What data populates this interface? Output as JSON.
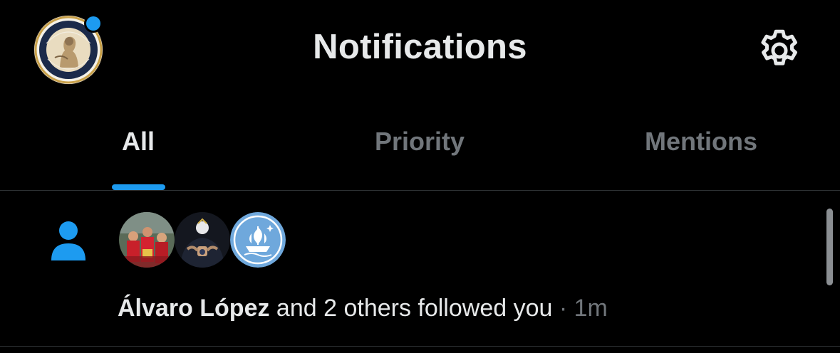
{
  "header": {
    "title": "Notifications",
    "avatar_icon": "profile-avatar",
    "settings_icon": "gear-icon"
  },
  "tabs": [
    {
      "label": "All",
      "active": true
    },
    {
      "label": "Priority",
      "active": false
    },
    {
      "label": "Mentions",
      "active": false
    }
  ],
  "notification": {
    "type_icon": "person-icon",
    "actor": "Álvaro López",
    "text": " and 2 others followed you",
    "separator": " · ",
    "time": "1m",
    "avatars": [
      "football-team-avatar",
      "real-madrid-avatar",
      "ship-logo-avatar"
    ]
  },
  "colors": {
    "accent": "#1d9bf0",
    "background": "#000000",
    "text_primary": "#e7e9ea",
    "text_secondary": "#71767b",
    "ship_badge": "#6fa8dc"
  }
}
